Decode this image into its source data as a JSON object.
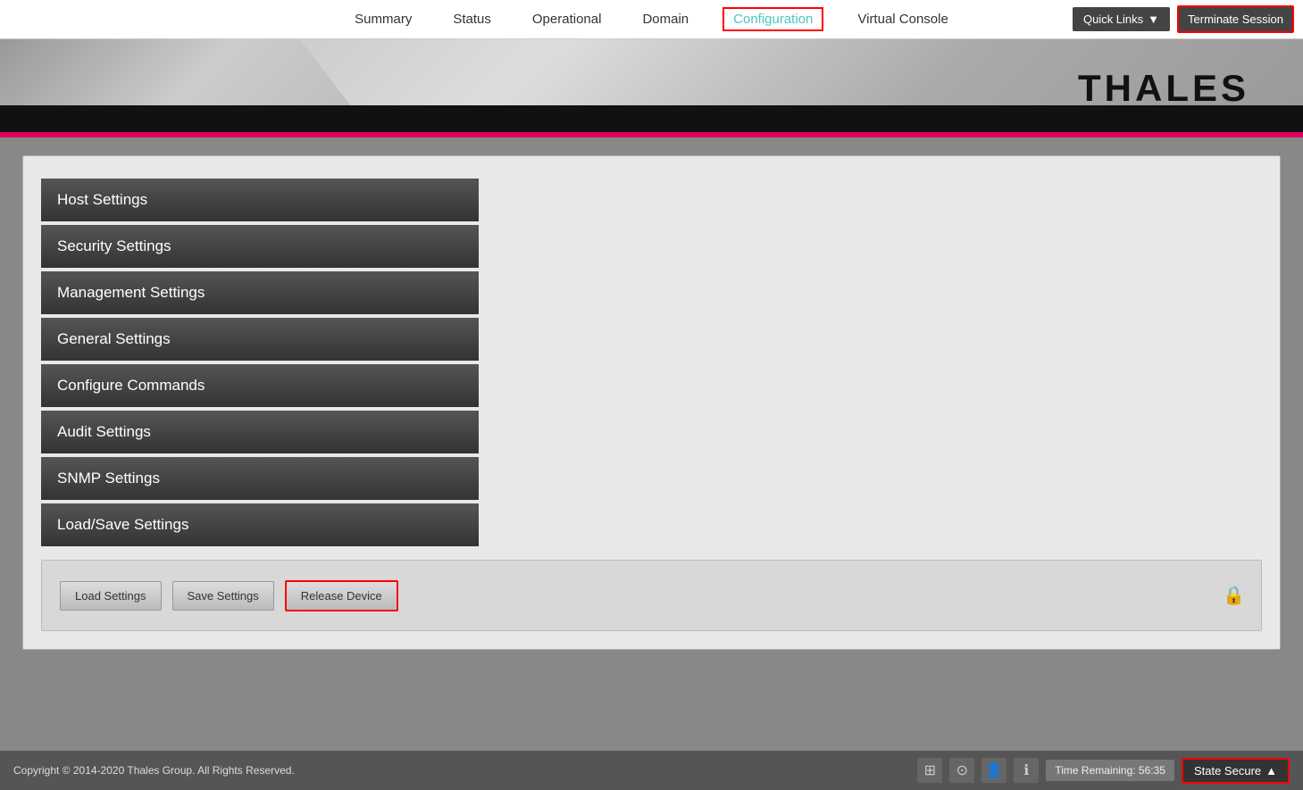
{
  "nav": {
    "items": [
      {
        "label": "Summary",
        "active": false
      },
      {
        "label": "Status",
        "active": false
      },
      {
        "label": "Operational",
        "active": false
      },
      {
        "label": "Domain",
        "active": false
      },
      {
        "label": "Configuration",
        "active": true
      },
      {
        "label": "Virtual Console",
        "active": false
      }
    ],
    "quick_links_label": "Quick Links",
    "terminate_session_label": "Terminate Session"
  },
  "header": {
    "logo_text": "THALES"
  },
  "sidebar": {
    "menu_items": [
      {
        "label": "Host Settings"
      },
      {
        "label": "Security Settings"
      },
      {
        "label": "Management Settings"
      },
      {
        "label": "General Settings"
      },
      {
        "label": "Configure Commands"
      },
      {
        "label": "Audit Settings"
      },
      {
        "label": "SNMP Settings"
      },
      {
        "label": "Load/Save Settings"
      }
    ]
  },
  "actions": {
    "load_settings": "Load Settings",
    "save_settings": "Save Settings",
    "release_device": "Release Device"
  },
  "footer": {
    "copyright": "Copyright © 2014-2020 Thales Group. All Rights Reserved.",
    "time_remaining": "Time Remaining: 56:35",
    "state_label": "State Secure"
  }
}
